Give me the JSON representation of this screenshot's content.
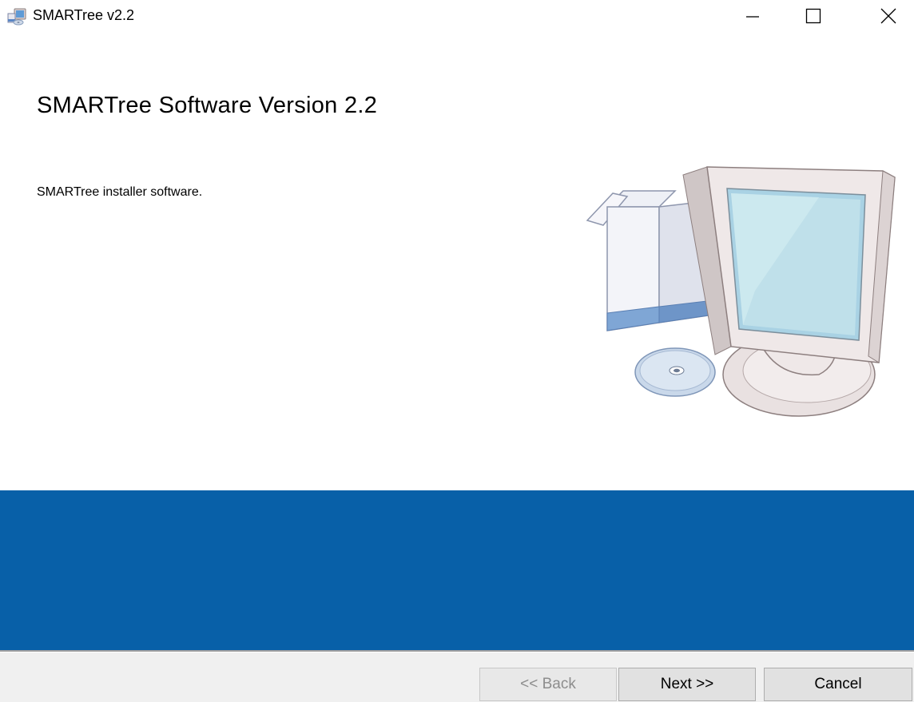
{
  "window": {
    "title": "SMARTree v2.2",
    "icon": "installer-app-icon",
    "controls": {
      "minimize": "minimize-icon",
      "maximize": "maximize-icon",
      "close": "close-icon"
    }
  },
  "content": {
    "heading": "SMARTree Software Version 2.2",
    "description": "SMARTree installer software.",
    "illustration": "computer-install-illustration"
  },
  "banner": {
    "color": "#0860a8"
  },
  "footer": {
    "back_label": "<< Back",
    "next_label": "Next >>",
    "cancel_label": "Cancel",
    "back_enabled": false
  }
}
